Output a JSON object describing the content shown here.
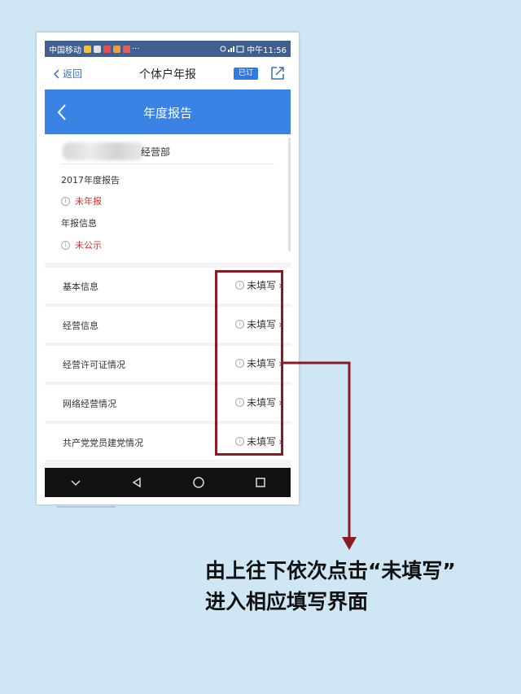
{
  "statusbar": {
    "carrier": "中国移动",
    "right_text": "中午11:56"
  },
  "topnav": {
    "back_label": "返回",
    "title": "个体户年报",
    "subscribe_label": "已订"
  },
  "header": {
    "title": "年度报告"
  },
  "info": {
    "company_suffix": "经营部",
    "report_year_label": "2017年度报告",
    "report_status": "未年报",
    "annual_info_label": "年报信息",
    "annual_info_status": "未公示"
  },
  "list": {
    "items": [
      {
        "label": "基本信息",
        "status": "未填写"
      },
      {
        "label": "经营信息",
        "status": "未填写"
      },
      {
        "label": "经营许可证情况",
        "status": "未填写"
      },
      {
        "label": "网络经营情况",
        "status": "未填写"
      },
      {
        "label": "共产党党员建党情况",
        "status": "未填写"
      }
    ]
  },
  "caption": {
    "line1": "由上往下依次点击“未填写”",
    "line2": "进入相应填写界面"
  },
  "colors": {
    "accent_blue": "#3a82e4",
    "status_red": "#d0342c",
    "highlight": "#8b1a22",
    "background": "#cfe6f4"
  }
}
